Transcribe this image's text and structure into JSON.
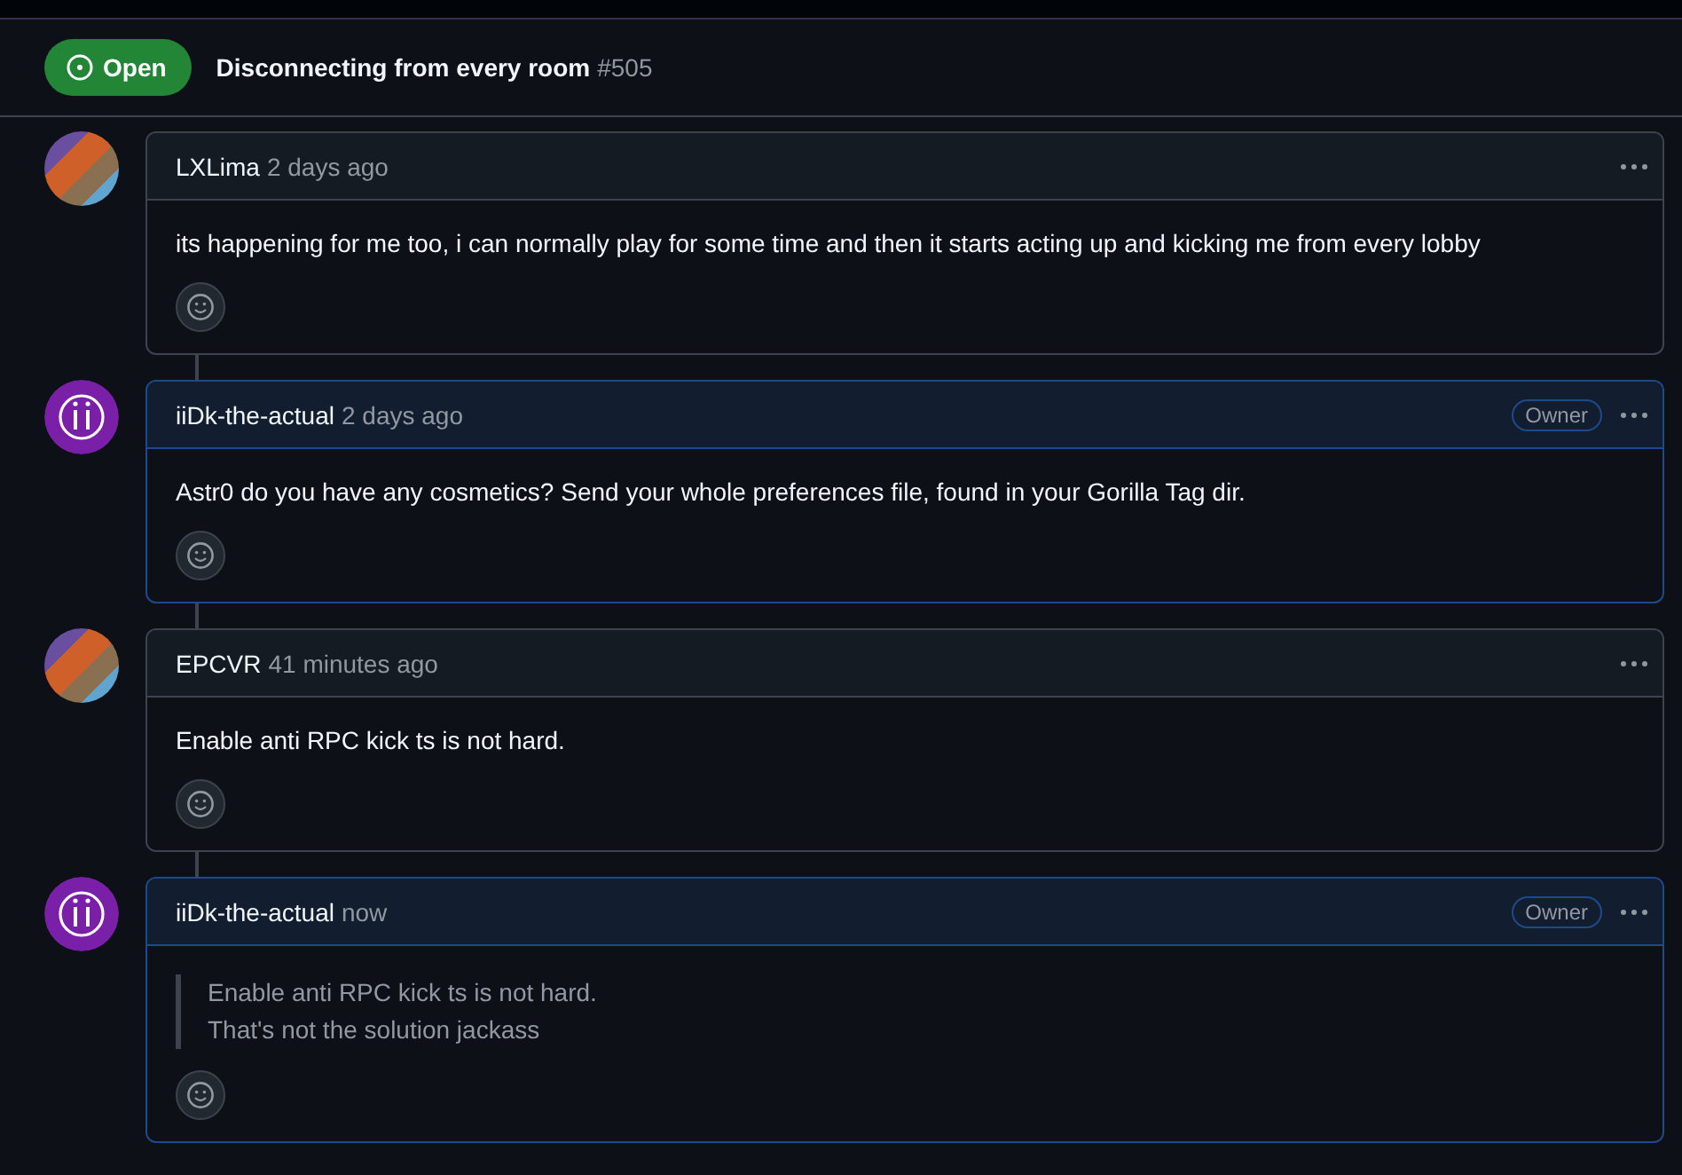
{
  "issue": {
    "state": "Open",
    "title": "Disconnecting from every room",
    "number": "#505"
  },
  "comments": [
    {
      "author": "LXLima",
      "time": "2 days ago",
      "owner": false,
      "avatar": {
        "kind": "photo"
      },
      "kind": "text",
      "body": [
        "its happening for me too, i can normally play for some time and then it starts acting up and kicking me from every lobby"
      ]
    },
    {
      "author": "iiDk-the-actual",
      "time": "2 days ago",
      "owner": true,
      "badge": "Owner",
      "avatar": {
        "kind": "logo"
      },
      "kind": "text",
      "body": [
        "Astr0 do you have any cosmetics? Send your whole preferences file, found in your Gorilla Tag dir."
      ]
    },
    {
      "author": "EPCVR",
      "time": "41 minutes ago",
      "owner": false,
      "avatar": {
        "kind": "photo"
      },
      "kind": "text",
      "body": [
        "Enable anti RPC kick ts is not hard."
      ]
    },
    {
      "author": "iiDk-the-actual",
      "time": "now",
      "owner": true,
      "badge": "Owner",
      "avatar": {
        "kind": "logo"
      },
      "kind": "quote",
      "body": [
        "Enable anti RPC kick ts is not hard.",
        "That's not the solution jackass"
      ]
    }
  ]
}
